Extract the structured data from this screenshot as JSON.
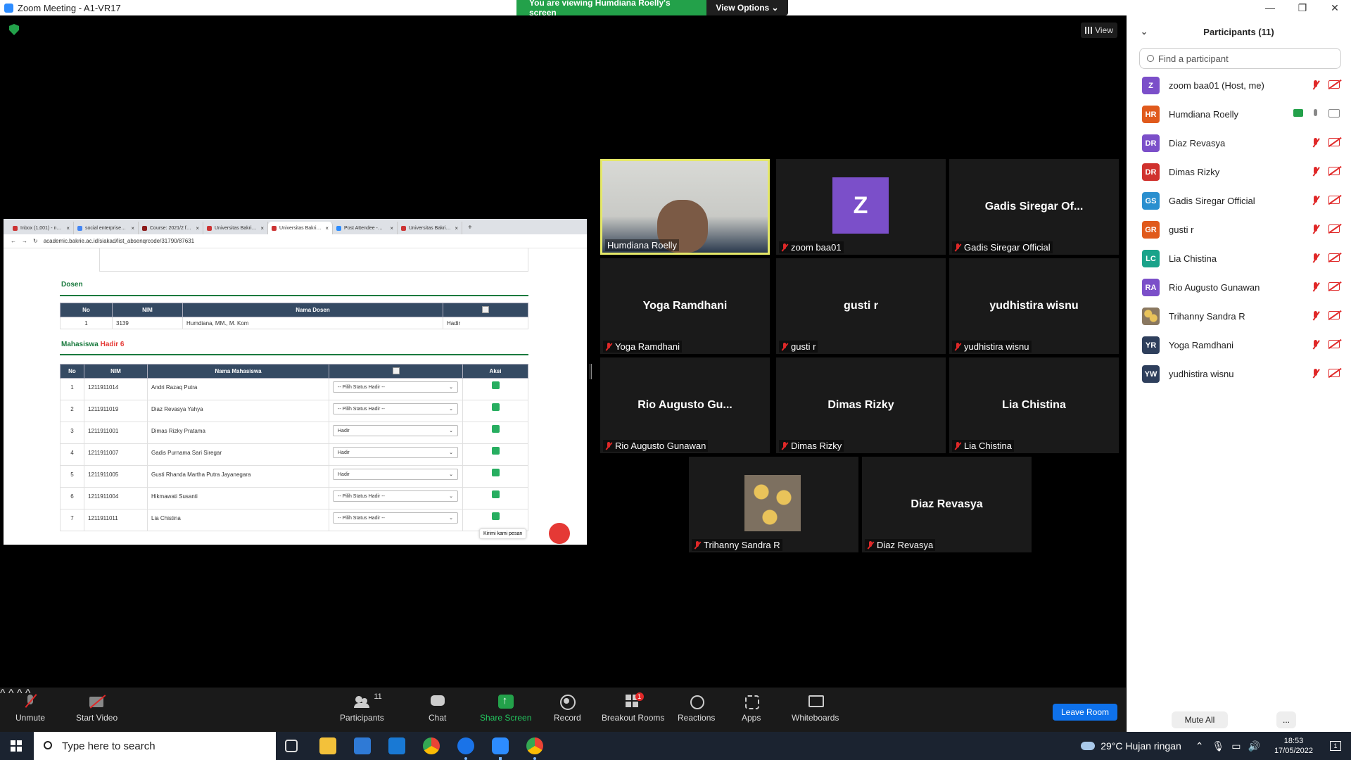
{
  "window": {
    "title": "Zoom Meeting - A1-VR17",
    "minimize": "—",
    "maximize": "❐",
    "close": "✕"
  },
  "banner": {
    "message": "You are viewing Humdiana Roelly's screen",
    "options": "View Options ⌄"
  },
  "view_button": "View",
  "shared_screen": {
    "tabs": [
      "Inbox (1,001) - n…",
      "social enterprise…",
      "Course: 2021/2 f…",
      "Universitas Bakri…",
      "Universitas Bakri…",
      "Post Attendee -…",
      "Universitas Bakri…"
    ],
    "url": "academic.bakrie.ac.id/siakad/list_absenqrcode/31790/87631",
    "dosen": {
      "title": "Dosen",
      "headers": [
        "No",
        "NIM",
        "Nama Dosen",
        ""
      ],
      "rows": [
        [
          "1",
          "3139",
          "Humdiana, MM., M. Kom",
          "Hadir"
        ]
      ]
    },
    "mahasiswa": {
      "title": "Mahasiswa",
      "hadir_label": "Hadir 6",
      "headers": [
        "No",
        "NIM",
        "Nama Mahasiswa",
        "",
        "Aksi"
      ],
      "rows": [
        {
          "no": "1",
          "nim": "1211911014",
          "nama": "Andri Razaq Putra",
          "status": "-- Pilih Status Hadir --"
        },
        {
          "no": "2",
          "nim": "1211911019",
          "nama": "Diaz Revasya Yahya",
          "status": "-- Pilih Status Hadir --"
        },
        {
          "no": "3",
          "nim": "1211911001",
          "nama": "Dimas Rizky Pratama",
          "status": "Hadir"
        },
        {
          "no": "4",
          "nim": "1211911007",
          "nama": "Gadis Purnama Sari Siregar",
          "status": "Hadir"
        },
        {
          "no": "5",
          "nim": "1211911005",
          "nama": "Gusti Rhanda Martha Putra Jayanegara",
          "status": "Hadir"
        },
        {
          "no": "6",
          "nim": "1211911004",
          "nama": "Hikmawati Susanti",
          "status": "-- Pilih Status Hadir --"
        },
        {
          "no": "7",
          "nim": "1211911011",
          "nama": "Lia Chistina",
          "status": "-- Pilih Status Hadir --"
        }
      ]
    },
    "chat_tooltip": "Kirimi kami pesan"
  },
  "tiles": [
    {
      "center": "",
      "label": "Humdiana Roelly",
      "type": "camera",
      "muted": false
    },
    {
      "center": "Z",
      "label": "zoom baa01",
      "type": "avatar",
      "muted": true
    },
    {
      "center": "Gadis Siregar Of...",
      "label": "Gadis Siregar Official",
      "type": "name",
      "muted": true
    },
    {
      "center": "Yoga Ramdhani",
      "label": "Yoga Ramdhani",
      "type": "name",
      "muted": true
    },
    {
      "center": "gusti r",
      "label": "gusti r",
      "type": "name",
      "muted": true
    },
    {
      "center": "yudhistira wisnu",
      "label": "yudhistira wisnu",
      "type": "name",
      "muted": true
    },
    {
      "center": "Rio Augusto Gu...",
      "label": "Rio Augusto Gunawan",
      "type": "name",
      "muted": true
    },
    {
      "center": "Dimas Rizky",
      "label": "Dimas Rizky",
      "type": "name",
      "muted": true
    },
    {
      "center": "Lia Chistina",
      "label": "Lia Chistina",
      "type": "name",
      "muted": true
    },
    {
      "center": "",
      "label": "Trihanny Sandra R",
      "type": "photo",
      "muted": true
    },
    {
      "center": "Diaz Revasya",
      "label": "Diaz Revasya",
      "type": "name",
      "muted": true
    }
  ],
  "participants": {
    "title": "Participants (11)",
    "search_placeholder": "Find a participant",
    "list": [
      {
        "initials": "Z",
        "name": "zoom baa01 (Host, me)",
        "color": "#7b4fc9",
        "sharing": false,
        "mic": "off",
        "cam": "off"
      },
      {
        "initials": "HR",
        "name": "Humdiana Roelly",
        "color": "#e05a1c",
        "sharing": true,
        "mic": "on",
        "cam": "on"
      },
      {
        "initials": "DR",
        "name": "Diaz Revasya",
        "color": "#7b4fc9",
        "sharing": false,
        "mic": "off",
        "cam": "off"
      },
      {
        "initials": "DR",
        "name": "Dimas Rizky",
        "color": "#d0312d",
        "sharing": false,
        "mic": "off",
        "cam": "off"
      },
      {
        "initials": "GS",
        "name": "Gadis Siregar Official",
        "color": "#2a8fcf",
        "sharing": false,
        "mic": "off",
        "cam": "off"
      },
      {
        "initials": "GR",
        "name": "gusti r",
        "color": "#e05a1c",
        "sharing": false,
        "mic": "off",
        "cam": "off"
      },
      {
        "initials": "LC",
        "name": "Lia Chistina",
        "color": "#1aa38a",
        "sharing": false,
        "mic": "off",
        "cam": "off"
      },
      {
        "initials": "RA",
        "name": "Rio Augusto Gunawan",
        "color": "#7b4fc9",
        "sharing": false,
        "mic": "off",
        "cam": "off"
      },
      {
        "initials": "",
        "name": "Trihanny Sandra R",
        "color": "#9a8060",
        "sharing": false,
        "mic": "off",
        "cam": "off"
      },
      {
        "initials": "YR",
        "name": "Yoga Ramdhani",
        "color": "#2e3f5c",
        "sharing": false,
        "mic": "off",
        "cam": "off"
      },
      {
        "initials": "YW",
        "name": "yudhistira wisnu",
        "color": "#2e3f5c",
        "sharing": false,
        "mic": "off",
        "cam": "off"
      }
    ],
    "mute_all": "Mute All",
    "more": "..."
  },
  "toolbar": {
    "unmute": "Unmute",
    "start_video": "Start Video",
    "participants": "Participants",
    "participants_count": "11",
    "chat": "Chat",
    "share_screen": "Share Screen",
    "record": "Record",
    "breakout_rooms": "Breakout Rooms",
    "breakout_badge": "1",
    "reactions": "Reactions",
    "apps": "Apps",
    "whiteboards": "Whiteboards",
    "leave": "Leave Room"
  },
  "taskbar": {
    "search_placeholder": "Type here to search",
    "weather": "29°C  Hujan ringan",
    "time": "18:53",
    "date": "17/05/2022",
    "notif_count": "1"
  }
}
